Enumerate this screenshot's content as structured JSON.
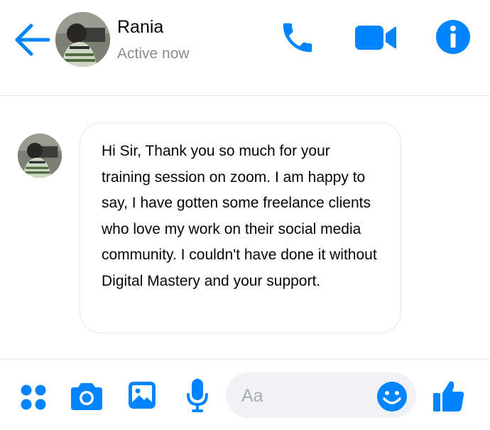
{
  "header": {
    "contact_name": "Rania",
    "status": "Active now",
    "avatar_icon": "person-avatar",
    "back_icon": "arrow-left-icon",
    "actions": [
      {
        "icon": "phone-icon"
      },
      {
        "icon": "video-camera-icon"
      },
      {
        "icon": "info-icon"
      }
    ]
  },
  "messages": [
    {
      "sender": "Rania",
      "text": "Hi Sir, Thank you so much for your training session on zoom. I am happy to say, I have gotten some freelance clients who love my work on their social media community. I couldn't have done it without Digital Mastery and your support."
    }
  ],
  "composer": {
    "placeholder": "Aa",
    "value": "",
    "icons": [
      "menu-dots-icon",
      "camera-icon",
      "image-icon",
      "microphone-icon",
      "emoji-icon",
      "thumbs-up-icon"
    ]
  },
  "colors": {
    "accent": "#0084ff",
    "text": "#050505",
    "muted": "#8a8d91",
    "divider": "#e4e6eb",
    "input_bg": "#f0f2f5"
  }
}
